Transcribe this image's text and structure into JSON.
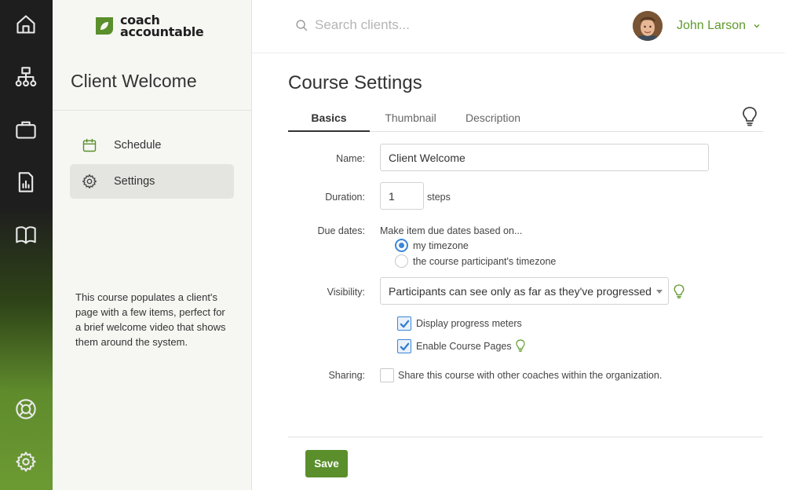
{
  "colors": {
    "brand_green": "#5a8f2b",
    "accent_blue": "#3b87d8",
    "rail_dark": "#1e1e1e"
  },
  "rail": {
    "items": [
      {
        "icon": "home-icon"
      },
      {
        "icon": "org-chart-icon"
      },
      {
        "icon": "briefcase-icon"
      },
      {
        "icon": "report-icon"
      },
      {
        "icon": "book-icon"
      },
      {
        "icon": "lifebuoy-icon"
      },
      {
        "icon": "gear-icon"
      }
    ]
  },
  "brand": {
    "line1": "coach",
    "line2": "accountable"
  },
  "course": {
    "title": "Client Welcome",
    "nav": [
      {
        "label": "Schedule",
        "icon": "calendar-icon"
      },
      {
        "label": "Settings",
        "icon": "gear-icon",
        "active": true
      }
    ],
    "description": "This course populates a client's page with a few items, perfect for a brief welcome video that shows them around the system."
  },
  "header": {
    "search_placeholder": "Search clients...",
    "user_name": "John Larson"
  },
  "main": {
    "title": "Course Settings",
    "tabs": [
      "Basics",
      "Thumbnail",
      "Description"
    ],
    "active_tab": "Basics",
    "form": {
      "name_label": "Name:",
      "name_value": "Client Welcome",
      "duration_label": "Duration:",
      "duration_value": "1",
      "duration_unit": "steps",
      "due_label": "Due dates:",
      "due_prompt": "Make item due dates based on...",
      "due_options": [
        "my timezone",
        "the course participant's timezone"
      ],
      "due_selected": "my timezone",
      "visibility_label": "Visibility:",
      "visibility_value": "Participants can see only as far as they've progressed",
      "progress_label": "Display progress meters",
      "progress_checked": true,
      "course_pages_label": "Enable Course Pages",
      "course_pages_checked": true,
      "sharing_label": "Sharing:",
      "sharing_text": "Share this course with other coaches within the organization.",
      "sharing_checked": false
    },
    "save_label": "Save"
  }
}
